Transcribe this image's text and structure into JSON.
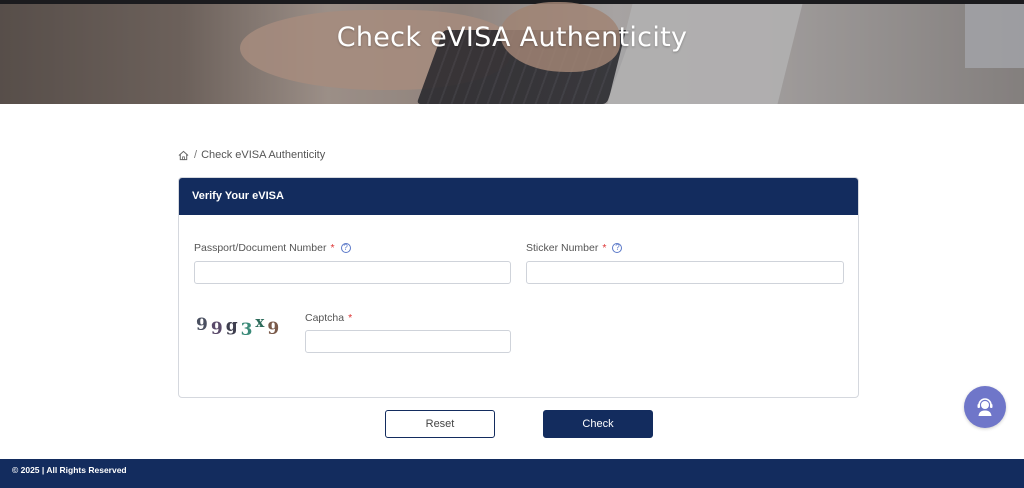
{
  "hero": {
    "title": "Check eVISA Authenticity"
  },
  "breadcrumb": {
    "separator": "/",
    "current": "Check eVISA Authenticity"
  },
  "form": {
    "header": "Verify Your eVISA",
    "passport": {
      "label": "Passport/Document Number",
      "required": "*",
      "value": ""
    },
    "sticker": {
      "label": "Sticker Number",
      "required": "*",
      "value": ""
    },
    "captcha": {
      "label": "Captcha",
      "required": "*",
      "value": "",
      "image_chars": [
        "9",
        "9",
        "g",
        "3",
        "x",
        "9"
      ]
    }
  },
  "buttons": {
    "reset": "Reset",
    "check": "Check"
  },
  "footer": {
    "text": "© 2025 | All Rights Reserved"
  },
  "colors": {
    "primary": "#132c5e",
    "required": "#dd3333",
    "support": "#6f76c9"
  },
  "icons": {
    "home": "home-icon",
    "help": "question-circle-icon",
    "support": "support-agent-icon"
  }
}
